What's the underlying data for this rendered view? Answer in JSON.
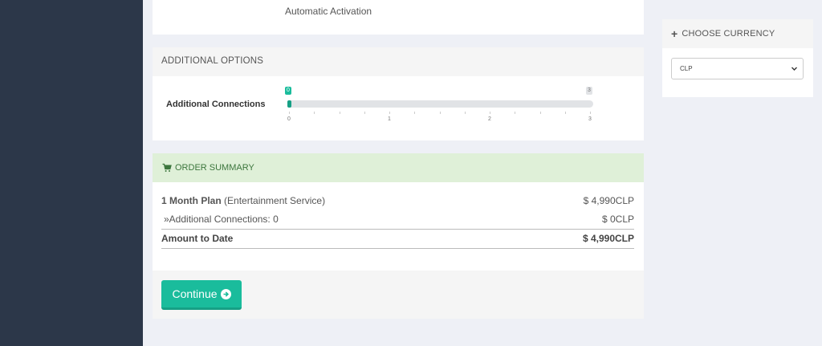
{
  "product": {
    "activation_text": "Automatic Activation"
  },
  "additional_options": {
    "heading": "ADDITIONAL OPTIONS",
    "connections_label": "Additional Connections",
    "slider": {
      "min": 0,
      "max": 3,
      "value": 0,
      "min_badge": "0",
      "max_badge": "3",
      "tick_labels": [
        "0",
        "1",
        "2",
        "3"
      ]
    }
  },
  "order_summary": {
    "heading": "ORDER SUMMARY",
    "plan_name": "1 Month Plan",
    "plan_detail": "(Entertainment Service)",
    "plan_amount": "$ 4,990CLP",
    "connections_line": "»Additional Connections: 0",
    "connections_amount": "$ 0CLP",
    "total_label": "Amount to Date",
    "total_amount": "$ 4,990CLP"
  },
  "footer": {
    "continue_label": "Continue"
  },
  "currency": {
    "heading": "CHOOSE CURRENCY",
    "selected": "CLP"
  },
  "colors": {
    "sidebar": "#2c3749",
    "accent": "#1abc9c",
    "summary_header": "#dff0d8",
    "summary_text": "#3c763d",
    "page_bg": "#eef0f6"
  },
  "icons": {
    "summary": "shopping-cart-icon",
    "continue": "arrow-circle-right-icon",
    "currency": "plus-icon",
    "select": "chevron-down-icon"
  }
}
